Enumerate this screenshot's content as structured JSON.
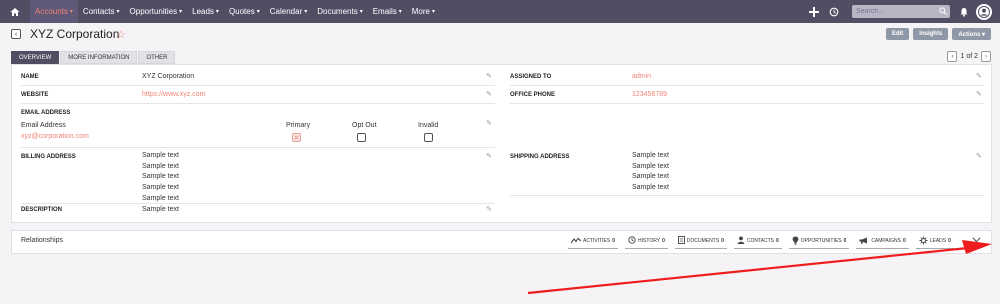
{
  "nav": {
    "items": [
      {
        "label": "Accounts",
        "active": true
      },
      {
        "label": "Contacts"
      },
      {
        "label": "Opportunities"
      },
      {
        "label": "Leads"
      },
      {
        "label": "Quotes"
      },
      {
        "label": "Calendar"
      },
      {
        "label": "Documents"
      },
      {
        "label": "Emails"
      },
      {
        "label": "More"
      }
    ],
    "caret": "▾",
    "search_placeholder": "Search..."
  },
  "header": {
    "title": "XYZ Corporation",
    "back": "‹",
    "star": "☆",
    "buttons": {
      "edit": "Edit",
      "insights": "Insights",
      "actions": "Actions ▾"
    }
  },
  "tabs": [
    {
      "label": "OVERVIEW",
      "active": true
    },
    {
      "label": "MORE INFORMATION"
    },
    {
      "label": "OTHER"
    }
  ],
  "pager": {
    "text": "1 of 2",
    "prev": "‹",
    "next": "›"
  },
  "fields": {
    "name": {
      "label": "NAME",
      "value": "XYZ Corporation"
    },
    "assigned_to": {
      "label": "ASSIGNED TO",
      "value": "admin"
    },
    "website": {
      "label": "WEBSITE",
      "value": "https://www.xyz.com"
    },
    "office_phone": {
      "label": "OFFICE PHONE",
      "value": "123456789"
    },
    "email": {
      "label": "EMAIL ADDRESS",
      "col_label": "Email Address",
      "value": "xyz@corporation.com",
      "primary": "Primary",
      "opt_out": "Opt Out",
      "invalid": "Invalid"
    },
    "billing": {
      "label": "BILLING ADDRESS",
      "lines": [
        "Sample text",
        "Sample text",
        "Sample text",
        "Sample text",
        "Sample text"
      ]
    },
    "shipping": {
      "label": "SHIPPING ADDRESS",
      "lines": [
        "Sample text",
        "Sample text",
        "Sample text",
        "Sample text"
      ]
    },
    "description": {
      "label": "DESCRIPTION",
      "value": "Sample text"
    }
  },
  "relationships": {
    "title": "Relationships",
    "tabs": [
      {
        "label": "ACTIVITIES",
        "count": "0",
        "icon": "activities-icon"
      },
      {
        "label": "HISTORY",
        "count": "0",
        "icon": "history-icon"
      },
      {
        "label": "DOCUMENTS",
        "count": "0",
        "icon": "documents-icon"
      },
      {
        "label": "CONTACTS",
        "count": "0",
        "icon": "contacts-icon"
      },
      {
        "label": "OPPORTUNITIES",
        "count": "0",
        "icon": "opportunities-icon"
      },
      {
        "label": "CAMPAIGNS",
        "count": "0",
        "icon": "campaigns-icon"
      },
      {
        "label": "LEADS",
        "count": "0",
        "icon": "leads-icon"
      }
    ]
  },
  "colors": {
    "nav_bg": "#534d64",
    "accent": "#f08377",
    "button": "#8f98a6",
    "annotation": "#ee1c1c"
  }
}
